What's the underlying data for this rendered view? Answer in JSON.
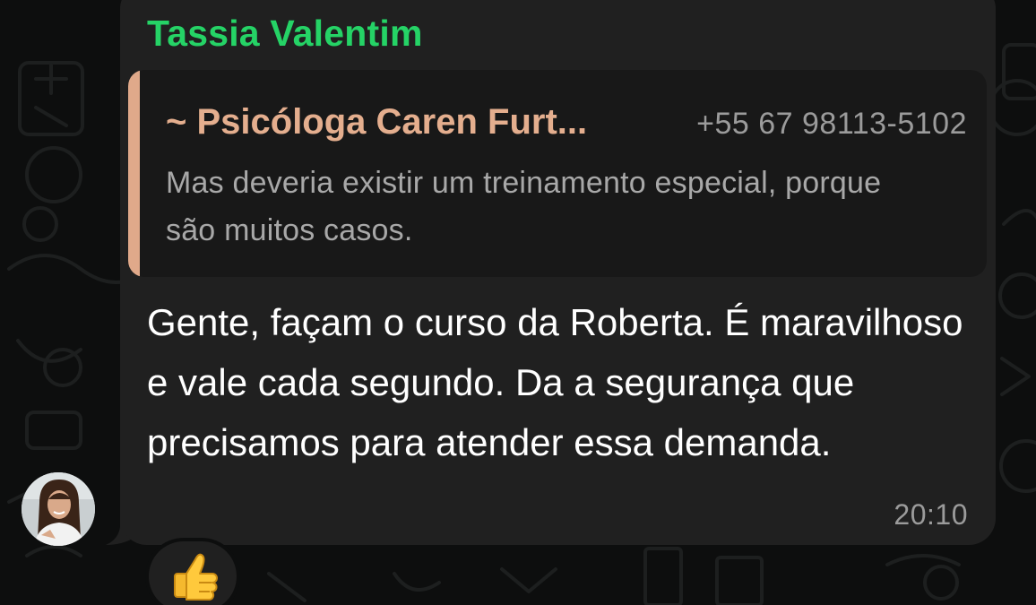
{
  "message": {
    "sender_name": "Tassia Valentim",
    "text": "Gente, façam o curso da Roberta. É maravilhoso e vale cada segundo. Da a segurança que precisamos para atender essa demanda.",
    "time": "20:10"
  },
  "quoted_message": {
    "author": "~ Psicóloga Caren Furt...",
    "phone": "+55 67 98113-5102",
    "text": "Mas deveria existir um treinamento especial, porque são muitos casos."
  },
  "reaction": {
    "icon": "thumbs-up-icon",
    "emoji": "👍"
  },
  "colors": {
    "sender": "#25d366",
    "quote_author": "#e4ae8e",
    "quote_bar": "#e0a98a",
    "bubble": "#202020",
    "background": "#0d0e0e"
  }
}
